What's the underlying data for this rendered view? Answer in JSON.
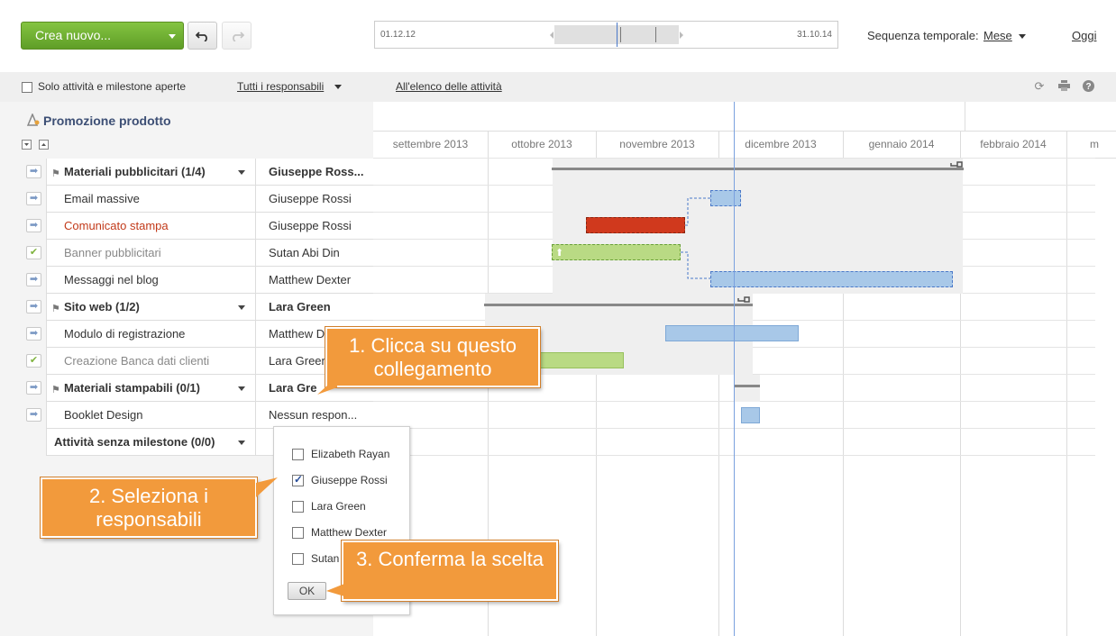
{
  "toolbar": {
    "create_label": "Crea nuovo...",
    "timeline_start": "01.12.12",
    "timeline_end": "31.10.14",
    "sequence_label": "Sequenza temporale:",
    "sequence_value": "Mese",
    "today_label": "Oggi"
  },
  "filters": {
    "open_only_label": "Solo attività e milestone aperte",
    "responsible_filter": "Tutti i responsabili",
    "all_tasks_link": "All'elenco delle attività"
  },
  "project": {
    "title": "Promozione prodotto"
  },
  "months": [
    "settembre 2013",
    "ottobre 2013",
    "novembre 2013",
    "dicembre 2013",
    "gennaio 2014",
    "febbraio 2014",
    "m"
  ],
  "rows": [
    {
      "name": "Materiali pubblicitari (1/4)",
      "resp": "Giuseppe Ross...",
      "group": true
    },
    {
      "name": "Email massive",
      "resp": "Giuseppe Rossi"
    },
    {
      "name": "Comunicato stampa",
      "resp": "Giuseppe Rossi",
      "state": "overdue"
    },
    {
      "name": "Banner pubblicitari",
      "resp": "Sutan Abi Din",
      "state": "done"
    },
    {
      "name": "Messaggi nel blog",
      "resp": "Matthew Dexter"
    },
    {
      "name": "Sito web (1/2)",
      "resp": "Lara Green",
      "group": true
    },
    {
      "name": "Modulo di registrazione",
      "resp": "Matthew D"
    },
    {
      "name": "Creazione Banca dati clienti",
      "resp": "Lara Green",
      "state": "done"
    },
    {
      "name": "Materiali stampabili (0/1)",
      "resp": "Lara Gre",
      "group": true
    },
    {
      "name": "Booklet Design",
      "resp": "Nessun respon..."
    },
    {
      "name": "Attività senza milestone (0/0)",
      "resp": "",
      "group": true,
      "nogrp": true
    }
  ],
  "dropdown": {
    "options": [
      {
        "label": "Elizabeth Rayan",
        "checked": false
      },
      {
        "label": "Giuseppe Rossi",
        "checked": true
      },
      {
        "label": "Lara Green",
        "checked": false
      },
      {
        "label": "Matthew Dexter",
        "checked": false
      },
      {
        "label": "Sutan",
        "checked": false
      }
    ],
    "ok_label": "OK"
  },
  "callouts": {
    "step1": "1. Clicca su questo collegamento",
    "step2": "2. Seleziona i responsabili",
    "step3": "3. Conferma la scelta"
  },
  "colors": {
    "primary": "#6aab2e",
    "task_blue": "#a8c8e8",
    "task_red": "#d0391d",
    "task_green": "#b9da84",
    "callout": "#f29a3c"
  },
  "icons": {
    "undo": "undo-icon",
    "redo": "redo-icon",
    "refresh": "refresh-icon",
    "print": "print-icon",
    "help": "help-icon"
  }
}
